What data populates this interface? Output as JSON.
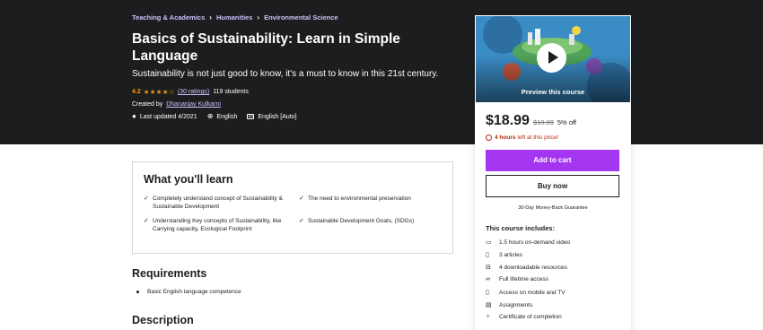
{
  "breadcrumbs": [
    "Teaching & Academics",
    "Humanities",
    "Environmental Science"
  ],
  "course": {
    "title": "Basics of Sustainability: Learn in Simple Language",
    "subtitle": "Sustainability is not just good to know, it's a must to know in this 21st century.",
    "rating": "4.2",
    "stars": "★★★★☆",
    "ratings_count": "(30 ratings)",
    "students": "119 students",
    "created_label": "Created by",
    "author": "Dhananjay Kulkarni",
    "last_updated": "Last updated 4/2021",
    "language": "English",
    "captions": "English [Auto]"
  },
  "learn": {
    "title": "What you'll learn",
    "items": [
      "Completely understand concept of Sustainability & Sustainable Development",
      "The need to environmental preservation",
      "Understanding Key concepts of Sustainability, like Carrying capacity, Ecological Footprint",
      "Sustainable Development Goals, (SDGs)"
    ]
  },
  "requirements": {
    "title": "Requirements",
    "items": [
      "Basic English language competence"
    ]
  },
  "description": {
    "title": "Description"
  },
  "sidebar": {
    "preview_label": "Preview this course",
    "price": "$18.99",
    "original_price": "$19.99",
    "discount": "5% off",
    "timer_bold": "4 hours",
    "timer_rest": "left at this price!",
    "add_to_cart": "Add to cart",
    "buy_now": "Buy now",
    "guarantee": "30-Day Money-Back Guarantee",
    "includes_title": "This course includes:",
    "includes": [
      {
        "icon": "video-icon",
        "text": "1.5 hours on-demand video"
      },
      {
        "icon": "article-icon",
        "text": "3 articles"
      },
      {
        "icon": "download-icon",
        "text": "4 downloadable resources"
      },
      {
        "icon": "infinity-icon",
        "text": "Full lifetime access"
      },
      {
        "icon": "mobile-icon",
        "text": "Access on mobile and TV"
      },
      {
        "icon": "assignment-icon",
        "text": "Assignments"
      },
      {
        "icon": "trophy-icon",
        "text": "Certificate of completion"
      }
    ]
  },
  "colors": {
    "hero_bg": "#1c1d1f",
    "accent_purple": "#a435f0",
    "link_lavender": "#cec0fc",
    "star_orange": "#e59819",
    "timer_red": "#b32d0f"
  }
}
